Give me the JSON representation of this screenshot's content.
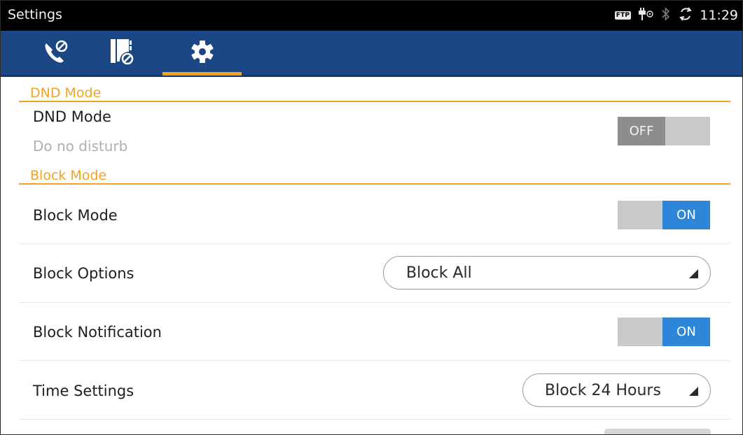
{
  "status_bar": {
    "title": "Settings",
    "ftp_badge": "FTP",
    "time": "11:29",
    "icons": [
      "ftp-icon",
      "usb-debug-icon",
      "bluetooth-icon",
      "sync-icon"
    ]
  },
  "tabs": [
    {
      "name": "call-settings",
      "icon": "phone-block-icon",
      "active": false
    },
    {
      "name": "contacts-block",
      "icon": "contact-block-icon",
      "active": false
    },
    {
      "name": "settings",
      "icon": "gear-icon",
      "active": true
    }
  ],
  "colors": {
    "tab_bar": "#1c4785",
    "accent_orange": "#efa521",
    "toggle_on": "#2e86d9",
    "toggle_off": "#8d8d8d"
  },
  "sections": {
    "dnd_header": "DND Mode",
    "block_header": "Block Mode"
  },
  "dnd": {
    "title": "DND Mode",
    "subtitle": "Do no disturb",
    "toggle_label": "OFF",
    "state": "off"
  },
  "block_mode": {
    "title": "Block Mode",
    "toggle_label": "ON",
    "state": "on"
  },
  "block_options": {
    "title": "Block Options",
    "selected": "Block All"
  },
  "block_notification": {
    "title": "Block Notification",
    "toggle_label": "ON",
    "state": "on"
  },
  "time_settings": {
    "title": "Time Settings",
    "selected": "Block 24 Hours"
  }
}
